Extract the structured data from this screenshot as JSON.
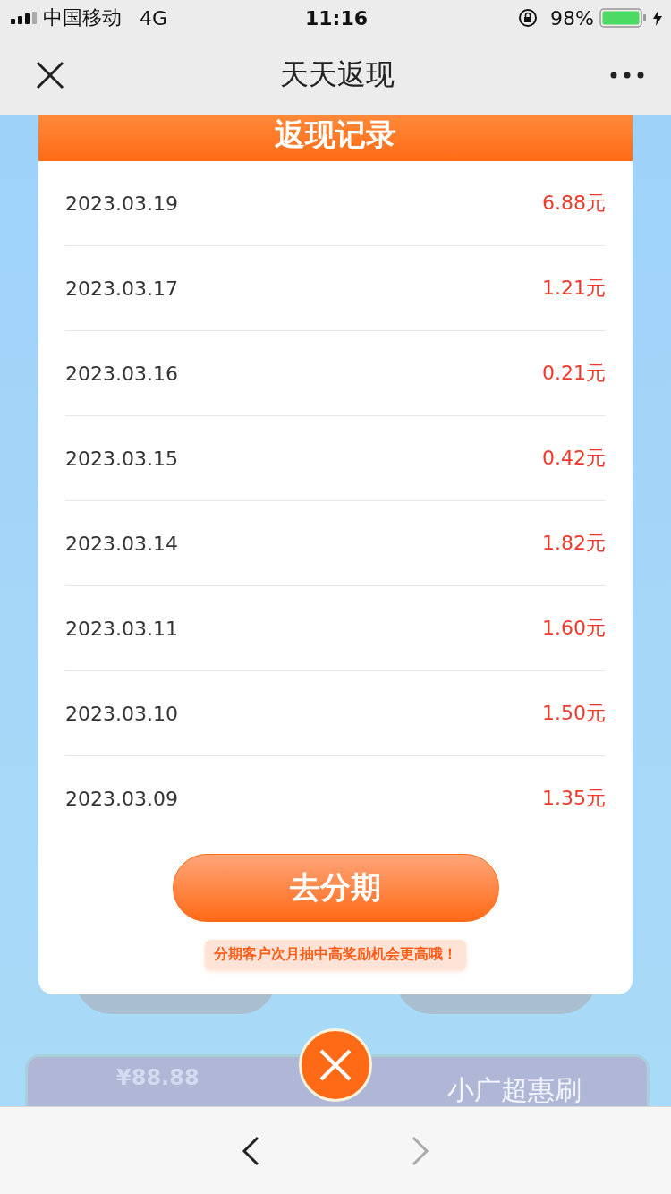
{
  "status_bar": {
    "carrier": "中国移动",
    "network": "4G",
    "time": "11:16",
    "battery": "98%"
  },
  "nav": {
    "title": "天天返现"
  },
  "background": {
    "voucher_amount": "¥88.88",
    "banner_text": "小广超惠刷"
  },
  "modal": {
    "title": "返现记录",
    "records": [
      {
        "date": "2023.03.19",
        "amount": "6.88元"
      },
      {
        "date": "2023.03.17",
        "amount": "1.21元"
      },
      {
        "date": "2023.03.16",
        "amount": "0.21元"
      },
      {
        "date": "2023.03.15",
        "amount": "0.42元"
      },
      {
        "date": "2023.03.14",
        "amount": "1.82元"
      },
      {
        "date": "2023.03.11",
        "amount": "1.60元"
      },
      {
        "date": "2023.03.10",
        "amount": "1.50元"
      },
      {
        "date": "2023.03.09",
        "amount": "1.35元"
      }
    ],
    "button": "去分期",
    "hint": "分期客户次月抽中高奖励机会更高哦！"
  },
  "toolbar": {
    "back": {
      "disabled": false
    },
    "forward": {
      "disabled": true
    }
  }
}
